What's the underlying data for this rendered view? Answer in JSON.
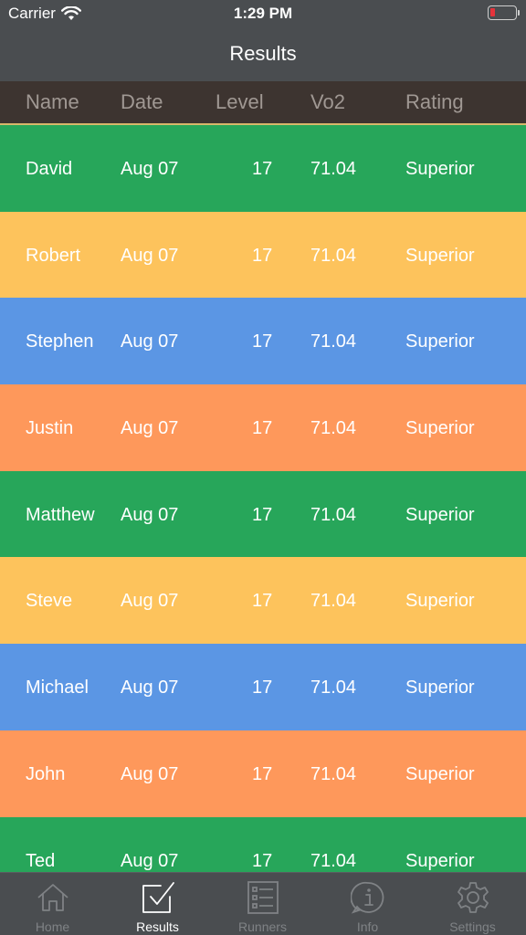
{
  "status_bar": {
    "carrier": "Carrier",
    "time": "1:29 PM"
  },
  "nav": {
    "title": "Results"
  },
  "table": {
    "columns": [
      "Name",
      "Date",
      "Level",
      "Vo2",
      "Rating"
    ],
    "rows": [
      {
        "name": "David",
        "date": "Aug 07",
        "level": "17",
        "vo2": "71.04",
        "rating": "Superior",
        "color": "#27a65a"
      },
      {
        "name": "Robert",
        "date": "Aug 07",
        "level": "17",
        "vo2": "71.04",
        "rating": "Superior",
        "color": "#fdc35c"
      },
      {
        "name": "Stephen",
        "date": "Aug 07",
        "level": "17",
        "vo2": "71.04",
        "rating": "Superior",
        "color": "#5b96e4"
      },
      {
        "name": "Justin",
        "date": "Aug 07",
        "level": "17",
        "vo2": "71.04",
        "rating": "Superior",
        "color": "#fe985b"
      },
      {
        "name": "Matthew",
        "date": "Aug 07",
        "level": "17",
        "vo2": "71.04",
        "rating": "Superior",
        "color": "#27a65a"
      },
      {
        "name": "Steve",
        "date": "Aug 07",
        "level": "17",
        "vo2": "71.04",
        "rating": "Superior",
        "color": "#fdc35c"
      },
      {
        "name": "Michael",
        "date": "Aug 07",
        "level": "17",
        "vo2": "71.04",
        "rating": "Superior",
        "color": "#5b96e4"
      },
      {
        "name": "John",
        "date": "Aug 07",
        "level": "17",
        "vo2": "71.04",
        "rating": "Superior",
        "color": "#fe985b"
      },
      {
        "name": "Ted",
        "date": "Aug 07",
        "level": "17",
        "vo2": "71.04",
        "rating": "Superior",
        "color": "#27a65a"
      }
    ]
  },
  "tabs": [
    {
      "label": "Home",
      "icon": "home-icon",
      "active": false
    },
    {
      "label": "Results",
      "icon": "results-icon",
      "active": true
    },
    {
      "label": "Runners",
      "icon": "runners-icon",
      "active": false
    },
    {
      "label": "Info",
      "icon": "info-icon",
      "active": false
    },
    {
      "label": "Settings",
      "icon": "settings-icon",
      "active": false
    }
  ]
}
